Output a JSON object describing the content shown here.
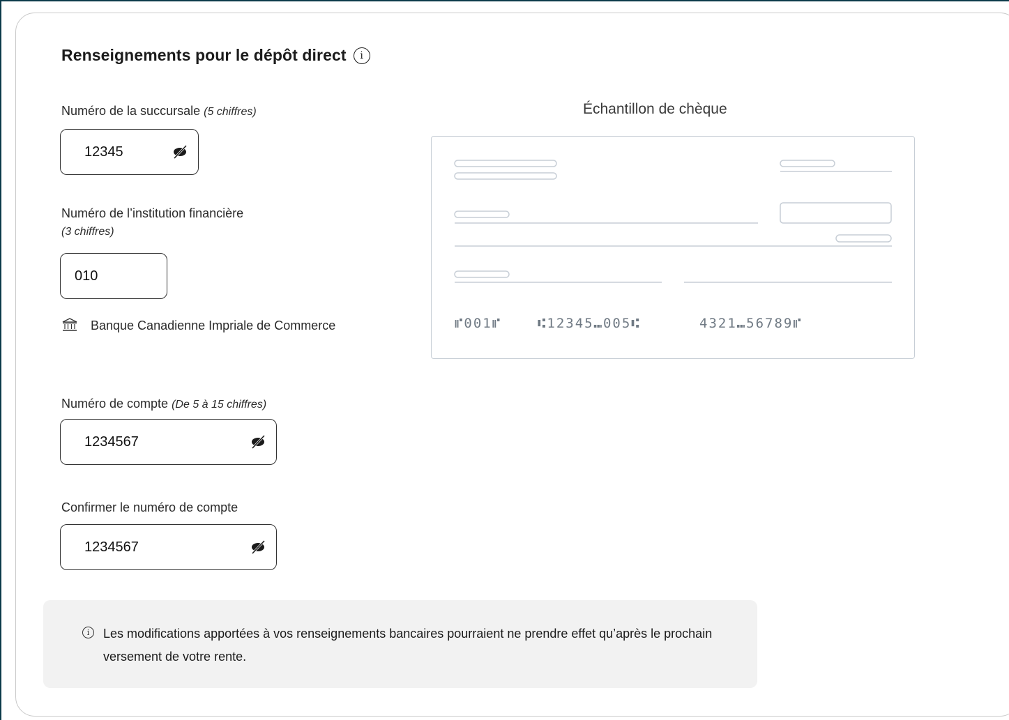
{
  "section": {
    "title": "Renseignements pour le dépôt direct",
    "info_icon": "info-icon"
  },
  "branch": {
    "label": "Numéro de la succursale",
    "hint": "(5 chiffres)",
    "value": "12345",
    "visibility_icon": "eye-slash-icon"
  },
  "institution": {
    "label": "Numéro de l’institution financière",
    "hint": "(3 chiffres)",
    "value": "010",
    "bank_icon": "bank-icon",
    "bank_name": "Banque Canadienne Impriale de Commerce"
  },
  "account": {
    "label": "Numéro de compte",
    "hint": "(De 5 à 15 chiffres)",
    "value": "1234567",
    "visibility_icon": "eye-slash-icon"
  },
  "confirm_account": {
    "label": "Confirmer le numéro de compte",
    "value": "1234567",
    "visibility_icon": "eye-slash-icon"
  },
  "cheque": {
    "title": "Échantillon de chèque",
    "micr_cheque": "⑈001⑈",
    "micr_transit": "⑆12345⑉005⑆",
    "micr_account": "4321⑉56789⑈",
    "line_color": "#c7ced6"
  },
  "notice": {
    "icon": "info-icon",
    "text": "Les modifications apportées à vos renseignements bancaires pourraient ne prendre effet qu’après le prochain versement de votre rente."
  }
}
